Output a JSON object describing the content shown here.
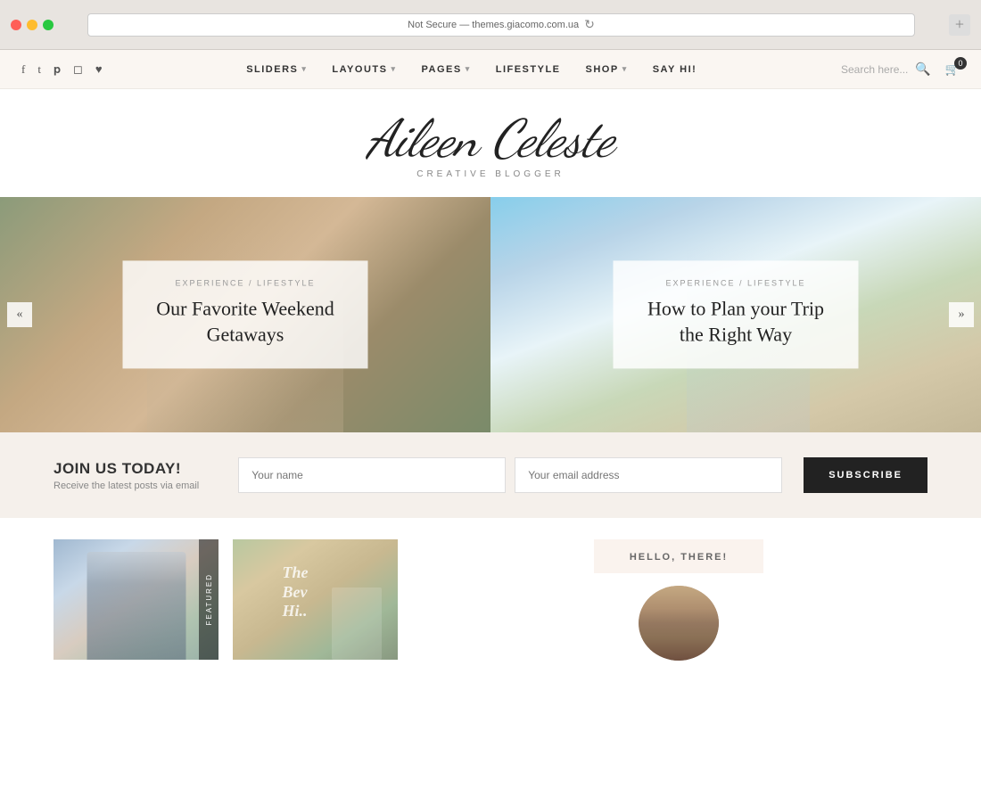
{
  "browser": {
    "address": "Not Secure — themes.giacomo.com.ua",
    "new_tab_label": "+"
  },
  "site": {
    "logo_name": "Aileen Celeste",
    "logo_tagline": "CREATIVE BLOGGER",
    "top_bar": {
      "social_icons": [
        "f",
        "t",
        "p",
        "i",
        "♥"
      ],
      "nav_items": [
        {
          "label": "SLIDERS",
          "has_arrow": true
        },
        {
          "label": "LAYOUTS",
          "has_arrow": true
        },
        {
          "label": "PAGES",
          "has_arrow": true
        },
        {
          "label": "LIFESTYLE",
          "has_arrow": false
        },
        {
          "label": "SHOP",
          "has_arrow": true
        },
        {
          "label": "SAY HI!",
          "has_arrow": false
        }
      ],
      "search_placeholder": "Search here...",
      "cart_count": "0"
    },
    "slider": {
      "left_arrow": "«",
      "right_arrow": "»",
      "slides": [
        {
          "category": "EXPERIENCE / LIFESTYLE",
          "title": "Our Favorite Weekend Getaways"
        },
        {
          "category": "EXPERIENCE / LIFESTYLE",
          "title": "How to Plan your Trip the Right Way"
        }
      ]
    },
    "subscribe": {
      "heading": "JOIN US TODAY!",
      "subtext": "Receive the latest posts via email",
      "name_placeholder": "Your name",
      "email_placeholder": "Your email address",
      "button_label": "SUBSCRIBE"
    },
    "bottom": {
      "featured_label": "FEATURED",
      "hello_label": "HELLO, THERE!"
    }
  }
}
